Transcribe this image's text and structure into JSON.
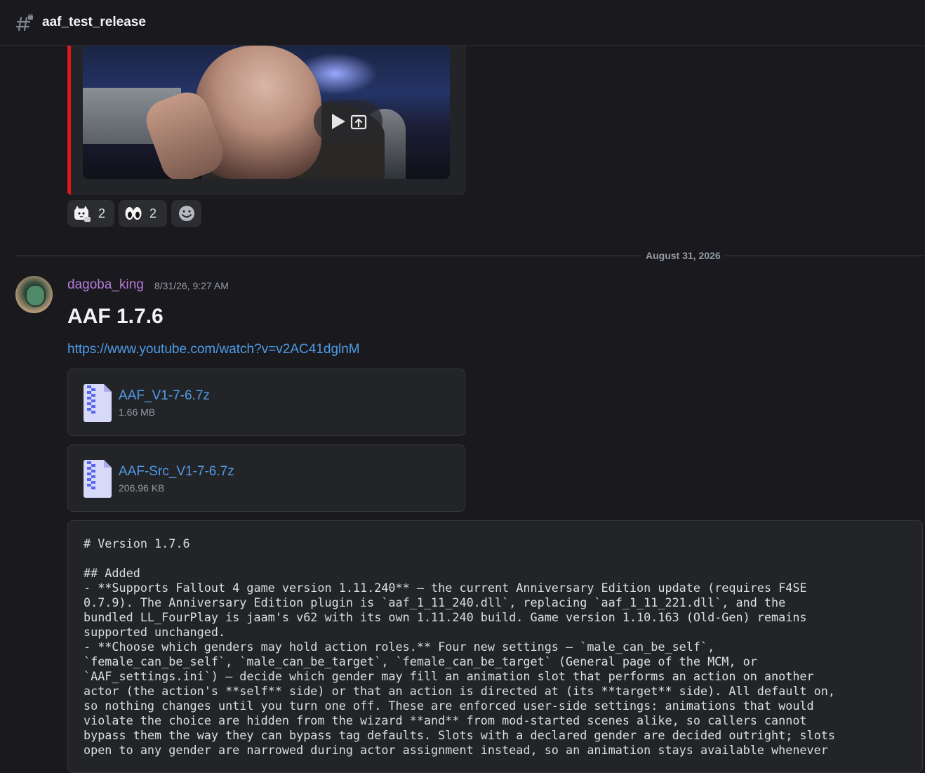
{
  "channel": {
    "name": "aaf_test_release",
    "icon": "hash-lock-icon"
  },
  "video": {
    "play_icon": "play-icon",
    "popout_icon": "open-in-browser-icon",
    "accent": "#e0171d"
  },
  "reactions": [
    {
      "emoji": "cat-emoji",
      "count": "2"
    },
    {
      "emoji": "eyes-emoji",
      "count": "2"
    },
    {
      "emoji": "add-reaction-icon",
      "count": ""
    }
  ],
  "divider": {
    "date": "August 31, 2026"
  },
  "message": {
    "author": "dagoba_king",
    "author_color": "#b57ad8",
    "timestamp": "8/31/26, 9:27 AM",
    "title": "AAF 1.7.6",
    "link": "https://www.youtube.com/watch?v=v2AC41dglnM"
  },
  "attachments": [
    {
      "name": "AAF_V1-7-6.7z",
      "size": "1.66 MB",
      "icon": "zip-file-icon"
    },
    {
      "name": "AAF-Src_V1-7-6.7z",
      "size": "206.96 KB",
      "icon": "zip-file-icon"
    }
  ],
  "code_lines": [
    "# Version 1.7.6",
    "",
    "## Added",
    "- **Supports Fallout 4 game version 1.11.240** — the current Anniversary Edition update (requires F4SE",
    "0.7.9). The Anniversary Edition plugin is `aaf_1_11_240.dll`, replacing `aaf_1_11_221.dll`, and the",
    "bundled LL_FourPlay is jaam's v62 with its own 1.11.240 build. Game version 1.10.163 (Old-Gen) remains",
    "supported unchanged.",
    "- **Choose which genders may hold action roles.** Four new settings — `male_can_be_self`,",
    "`female_can_be_self`, `male_can_be_target`, `female_can_be_target` (General page of the MCM, or",
    "`AAF_settings.ini`) — decide which gender may fill an animation slot that performs an action on another",
    "actor (the action's **self** side) or that an action is directed at (its **target** side). All default on,",
    "so nothing changes until you turn one off. These are enforced user-side settings: animations that would",
    "violate the choice are hidden from the wizard **and** from mod-started scenes alike, so callers cannot",
    "bypass them the way they can bypass tag defaults. Slots with a declared gender are decided outright; slots",
    "open to any gender are narrowed during actor assignment instead, so an animation stays available whenever"
  ]
}
